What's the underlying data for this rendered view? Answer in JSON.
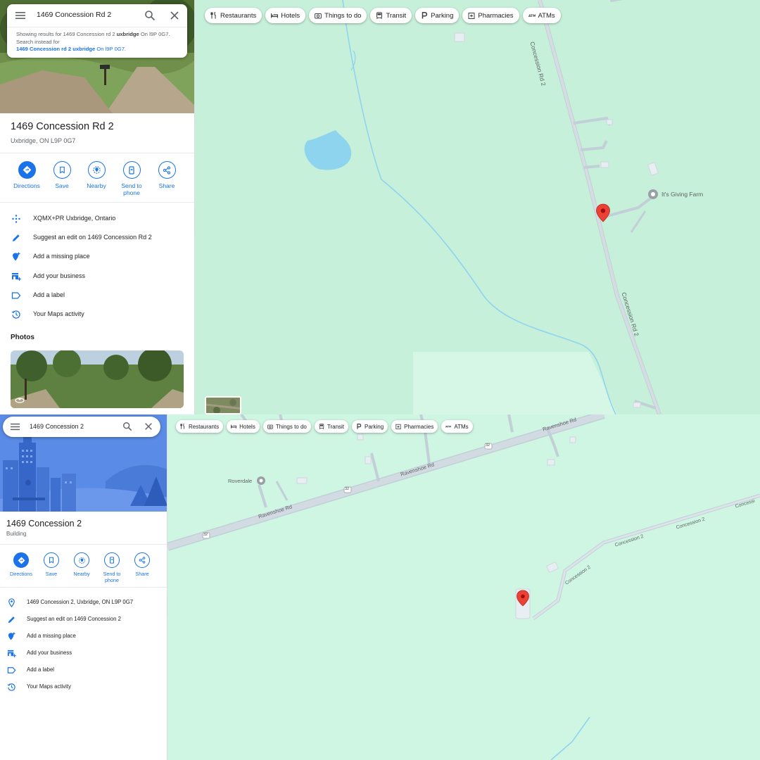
{
  "top": {
    "search": {
      "query": "1469 Concession Rd 2"
    },
    "suggestion": {
      "prefix": "Showing results for 1469 Concession rd 2 ",
      "bold": "uxbridge",
      "suffix": " On l9P 0G7. Search instead for",
      "link_bold": "1469 Concession rd 2 uxbridge",
      "link_rest": " On l9P 0G7."
    },
    "place": {
      "title": "1469 Concession Rd 2",
      "subtitle": "Uxbridge, ON L9P 0G7"
    },
    "actions": [
      {
        "label": "Directions"
      },
      {
        "label": "Save"
      },
      {
        "label": "Nearby"
      },
      {
        "label": "Send to phone"
      },
      {
        "label": "Share"
      }
    ],
    "details": [
      {
        "icon": "plus-code-icon",
        "text": "XQMX+PR Uxbridge, Ontario"
      },
      {
        "icon": "edit-icon",
        "text": "Suggest an edit on 1469 Concession Rd 2"
      },
      {
        "icon": "add-place-icon",
        "text": "Add a missing place"
      },
      {
        "icon": "add-business-icon",
        "text": "Add your business"
      },
      {
        "icon": "label-icon",
        "text": "Add a label"
      },
      {
        "icon": "history-icon",
        "text": "Your Maps activity"
      }
    ],
    "photos_heading": "Photos",
    "chips": [
      "Restaurants",
      "Hotels",
      "Things to do",
      "Transit",
      "Parking",
      "Pharmacies",
      "ATMs"
    ],
    "map_labels": {
      "road_north": "Concession Rd 2",
      "road_south": "Concession Rd 2",
      "poi": "It's Giving Farm"
    }
  },
  "bottom": {
    "search": {
      "query": "1469 Concession 2"
    },
    "place": {
      "title": "1469 Concession 2",
      "subtitle": "Building"
    },
    "actions": [
      {
        "label": "Directions"
      },
      {
        "label": "Save"
      },
      {
        "label": "Nearby"
      },
      {
        "label": "Send to phone"
      },
      {
        "label": "Share"
      }
    ],
    "details": [
      {
        "icon": "location-pin-icon",
        "text": "1469 Concession 2, Uxbridge, ON L9P 0G7"
      },
      {
        "icon": "edit-icon",
        "text": "Suggest an edit on 1469 Concession 2"
      },
      {
        "icon": "add-place-icon",
        "text": "Add a missing place"
      },
      {
        "icon": "add-business-icon",
        "text": "Add your business"
      },
      {
        "icon": "label-icon",
        "text": "Add a label"
      },
      {
        "icon": "history-icon",
        "text": "Your Maps activity"
      }
    ],
    "chips": [
      "Restaurants",
      "Hotels",
      "Things to do",
      "Transit",
      "Parking",
      "Pharmacies",
      "ATMs"
    ],
    "map_labels": {
      "ravenshoe_1": "Ravenshoe Rd",
      "ravenshoe_2": "Ravenshoe Rd",
      "ravenshoe_3": "Ravenshoe Rd",
      "route_1": "32",
      "route_2": "32",
      "route_3": "32",
      "route_4": "32",
      "conc_1": "Concession 2",
      "conc_2": "Concession 2",
      "conc_3": "Concession 2",
      "conc_4": "Concessi",
      "poi": "Roverdale"
    }
  },
  "colors": {
    "accent": "#1a73e8",
    "map_top": "#c6f0d9",
    "map_bottom": "#cff5e3",
    "road": "#c2cfd8",
    "water": "#8fd4ef",
    "pin": "#ea4335"
  }
}
